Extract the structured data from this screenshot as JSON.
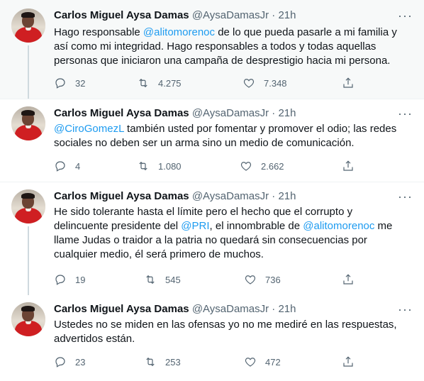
{
  "tweets": [
    {
      "name": "Carlos Miguel Aysa Damas",
      "handle": "@AysaDamasJr",
      "dot": "·",
      "time": "21h",
      "more": "···",
      "text": [
        {
          "t": "Hago responsable ",
          "m": false
        },
        {
          "t": "@alitomorenoc",
          "m": true
        },
        {
          "t": " de lo que pueda pasarle a mi familia y así como mi integridad. Hago responsables a todos y todas aquellas personas que iniciaron una campaña de desprestigio hacia mi persona.",
          "m": false
        }
      ],
      "replies": "32",
      "retweets": "4.275",
      "likes": "7.348"
    },
    {
      "name": "Carlos Miguel Aysa Damas",
      "handle": "@AysaDamasJr",
      "dot": "·",
      "time": "21h",
      "more": "···",
      "text": [
        {
          "t": "@CiroGomezL",
          "m": true
        },
        {
          "t": " también usted por fomentar y promover el odio; las redes sociales no deben ser un arma sino un medio de comunicación.",
          "m": false
        }
      ],
      "replies": "4",
      "retweets": "1.080",
      "likes": "2.662"
    },
    {
      "name": "Carlos Miguel Aysa Damas",
      "handle": "@AysaDamasJr",
      "dot": "·",
      "time": "21h",
      "more": "···",
      "text": [
        {
          "t": "He sido tolerante hasta el límite pero el hecho que el corrupto y delincuente presidente del ",
          "m": false
        },
        {
          "t": "@PRI",
          "m": true
        },
        {
          "t": ", el innombrable de ",
          "m": false
        },
        {
          "t": "@alitomorenoc",
          "m": true
        },
        {
          "t": " me llame Judas o traidor a la patria no quedará sin consecuencias por cualquier medio, él será primero de muchos.",
          "m": false
        }
      ],
      "replies": "19",
      "retweets": "545",
      "likes": "736"
    },
    {
      "name": "Carlos Miguel Aysa Damas",
      "handle": "@AysaDamasJr",
      "dot": "·",
      "time": "21h",
      "more": "···",
      "text": [
        {
          "t": "Ustedes no se miden en las ofensas yo no me mediré en las respuestas, advertidos están.",
          "m": false
        }
      ],
      "replies": "23",
      "retweets": "253",
      "likes": "472"
    }
  ],
  "colors": {
    "mention": "#1d9bf0",
    "muted": "#536471",
    "text": "#0f1419"
  },
  "icons": [
    "reply-icon",
    "retweet-icon",
    "like-icon",
    "share-icon",
    "more-icon"
  ]
}
